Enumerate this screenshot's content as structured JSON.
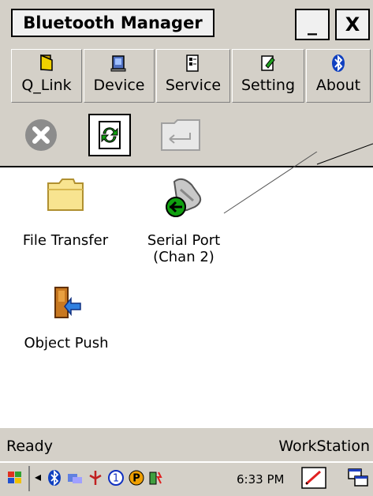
{
  "window": {
    "title": "Bluetooth Manager",
    "minimize_label": "_",
    "close_label": "X"
  },
  "menu": [
    {
      "label": "Q_Link",
      "icon": "link-icon"
    },
    {
      "label": "Device",
      "icon": "device-icon"
    },
    {
      "label": "Service",
      "icon": "service-icon"
    },
    {
      "label": "Setting",
      "icon": "setting-icon"
    },
    {
      "label": "About",
      "icon": "bluetooth-icon"
    }
  ],
  "toolbar": [
    {
      "icon": "stop-icon",
      "enabled": true
    },
    {
      "icon": "refresh-icon",
      "enabled": true
    },
    {
      "icon": "folder-back-icon",
      "enabled": false
    }
  ],
  "services": [
    {
      "label_line1": "File Transfer",
      "label_line2": "",
      "icon": "folder-icon"
    },
    {
      "label_line1": "Serial Port",
      "label_line2": "(Chan 2)",
      "icon": "serial-port-icon"
    },
    {
      "label_line1": "Object Push",
      "label_line2": "",
      "icon": "object-push-icon"
    }
  ],
  "status": {
    "left": "Ready",
    "right": "WorkStation"
  },
  "taskbar": {
    "clock": "6:33 PM"
  }
}
